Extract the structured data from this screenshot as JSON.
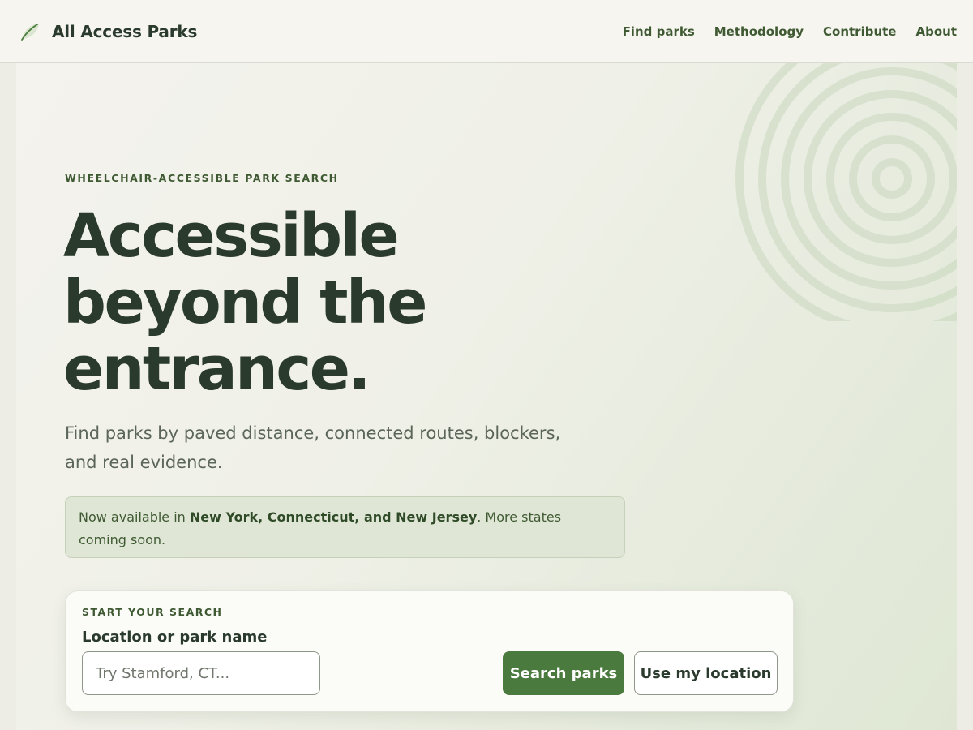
{
  "header": {
    "brand_name": "All Access Parks",
    "logo_icon": "leaf-icon",
    "nav": [
      {
        "label": "Find parks"
      },
      {
        "label": "Methodology"
      },
      {
        "label": "Contribute"
      },
      {
        "label": "About"
      }
    ]
  },
  "hero": {
    "eyebrow": "WHEELCHAIR-ACCESSIBLE PARK SEARCH",
    "headline_lines": [
      "Accessible",
      "beyond the",
      "entrance."
    ],
    "subtitle": "Find parks by paved distance, connected routes, blockers, and real evidence.",
    "decoration_icon": "concentric-rings-icon",
    "notice": {
      "prefix": "Now available in ",
      "states": "New York, Connecticut, and New Jersey",
      "suffix": ". More states coming soon."
    }
  },
  "search": {
    "card_label": "START YOUR SEARCH",
    "field_label": "Location or park name",
    "input_value": "",
    "placeholder": "Try Stamford, CT...",
    "primary_button": "Search parks",
    "secondary_button": "Use my location"
  },
  "colors": {
    "accent": "#4a7a3d",
    "text_dark": "#2a3a2c",
    "notice_bg": "#dfe6d6",
    "page_bg": "#f6f5f0"
  }
}
